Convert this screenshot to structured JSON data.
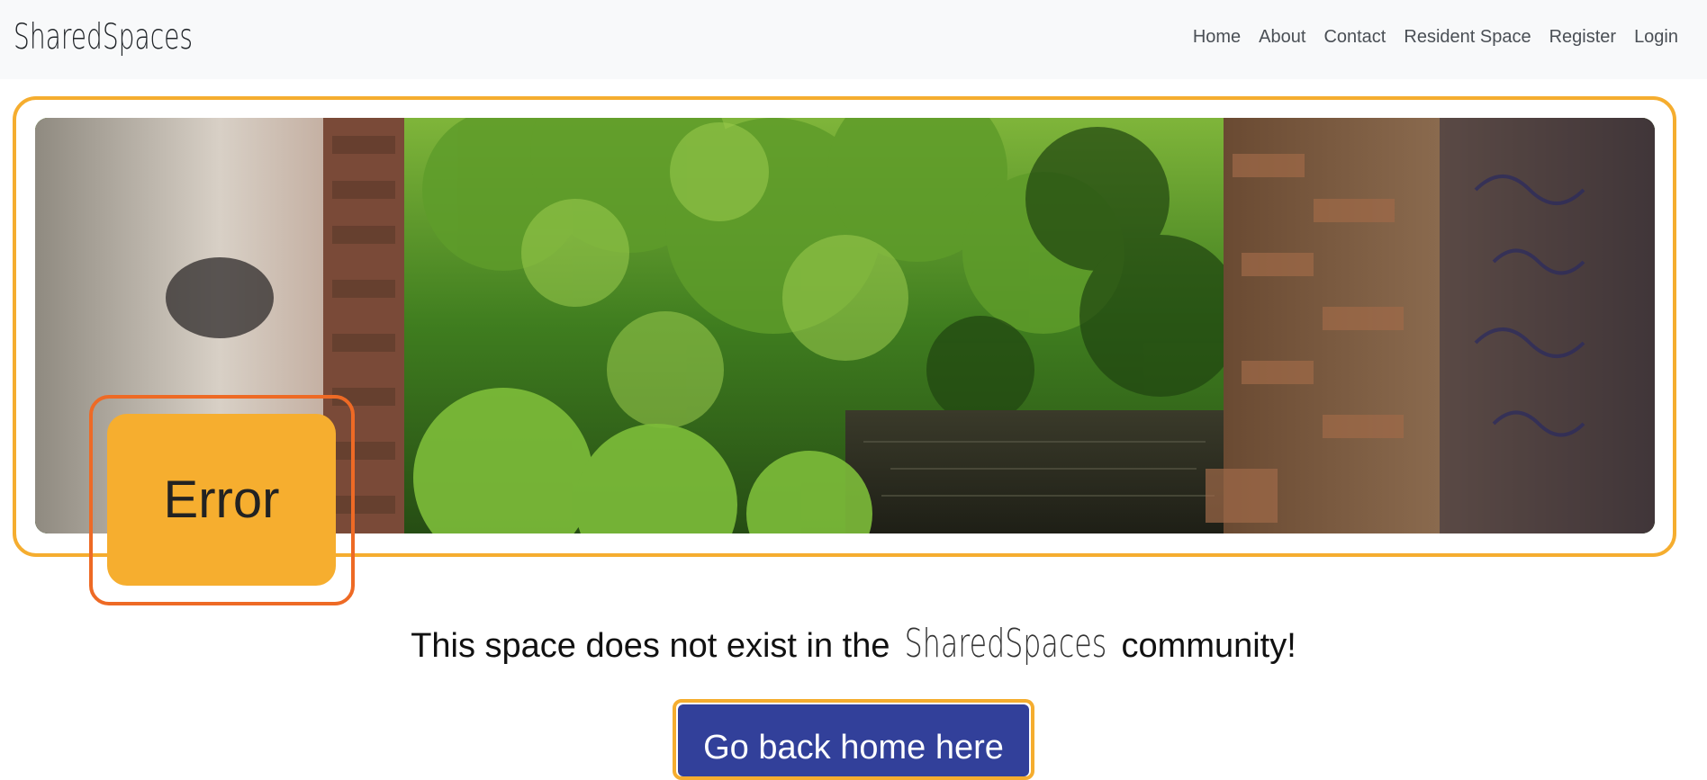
{
  "navbar": {
    "brand": "SharedSpaces",
    "links": [
      {
        "label": "Home"
      },
      {
        "label": "About"
      },
      {
        "label": "Contact"
      },
      {
        "label": "Resident Space"
      },
      {
        "label": "Register"
      },
      {
        "label": "Login"
      }
    ]
  },
  "hero": {
    "error_label": "Error"
  },
  "message": {
    "prefix": "This space does not exist in the ",
    "brand": "SharedSpaces",
    "suffix": " community!"
  },
  "button": {
    "label": "Go back home here"
  },
  "colors": {
    "accent_orange": "#f5ad2f",
    "outline_orange": "#ee6a25",
    "button_blue": "#32409a",
    "navbar_bg": "#f8f9fa"
  }
}
